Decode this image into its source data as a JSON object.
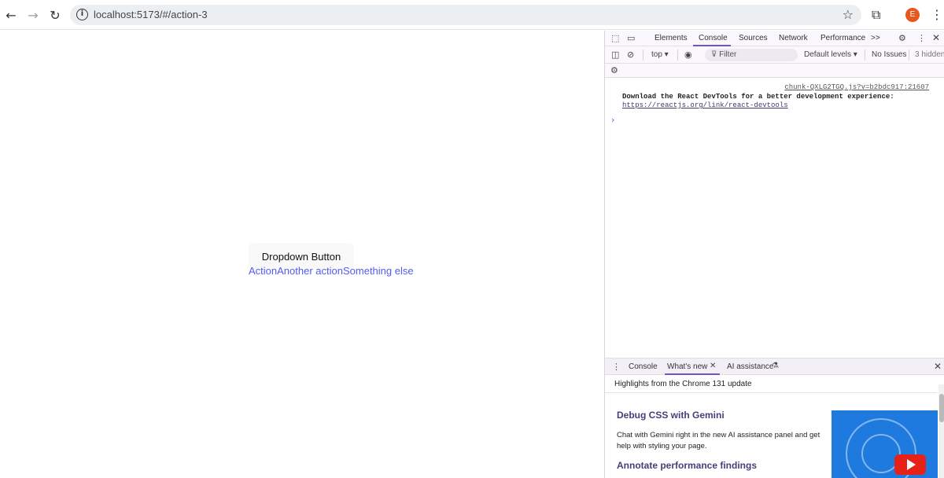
{
  "browser": {
    "back_icon": "arrow-left-icon",
    "forward_icon": "arrow-right-icon",
    "reload_icon": "reload-icon",
    "url": "localhost:5173/#/action-3",
    "avatar_letter": "E"
  },
  "page": {
    "dropdown_button_label": "Dropdown Button",
    "menu_items": [
      "Action",
      "Another action",
      "Something else"
    ],
    "accent_color": "#535bf2"
  },
  "devtools": {
    "tabs": [
      "Elements",
      "Console",
      "Sources",
      "Network",
      "Performance"
    ],
    "more_tabs": ">>",
    "active_tab": "Console",
    "toolbar": {
      "context": "top",
      "filter_placeholder": "Filter",
      "levels": "Default levels",
      "issues": "No Issues",
      "hidden": "3 hidden"
    },
    "console_message": {
      "source": "chunk-QXLG2TGQ.js?v=b2bdc917:21607",
      "text": "Download the React DevTools for a better development experience:",
      "link": "https://reactjs.org/link/react-devtools"
    },
    "prompt": "›",
    "drawer": {
      "tabs": [
        "Console",
        "What's new",
        "AI assistance"
      ],
      "active_tab": "What's new",
      "highlights": "Highlights from the Chrome 131 update",
      "section1_title": "Debug CSS with Gemini",
      "section1_body": "Chat with Gemini right in the new AI assistance panel and get help with styling your page.",
      "section2_title": "Annotate performance findings"
    }
  }
}
